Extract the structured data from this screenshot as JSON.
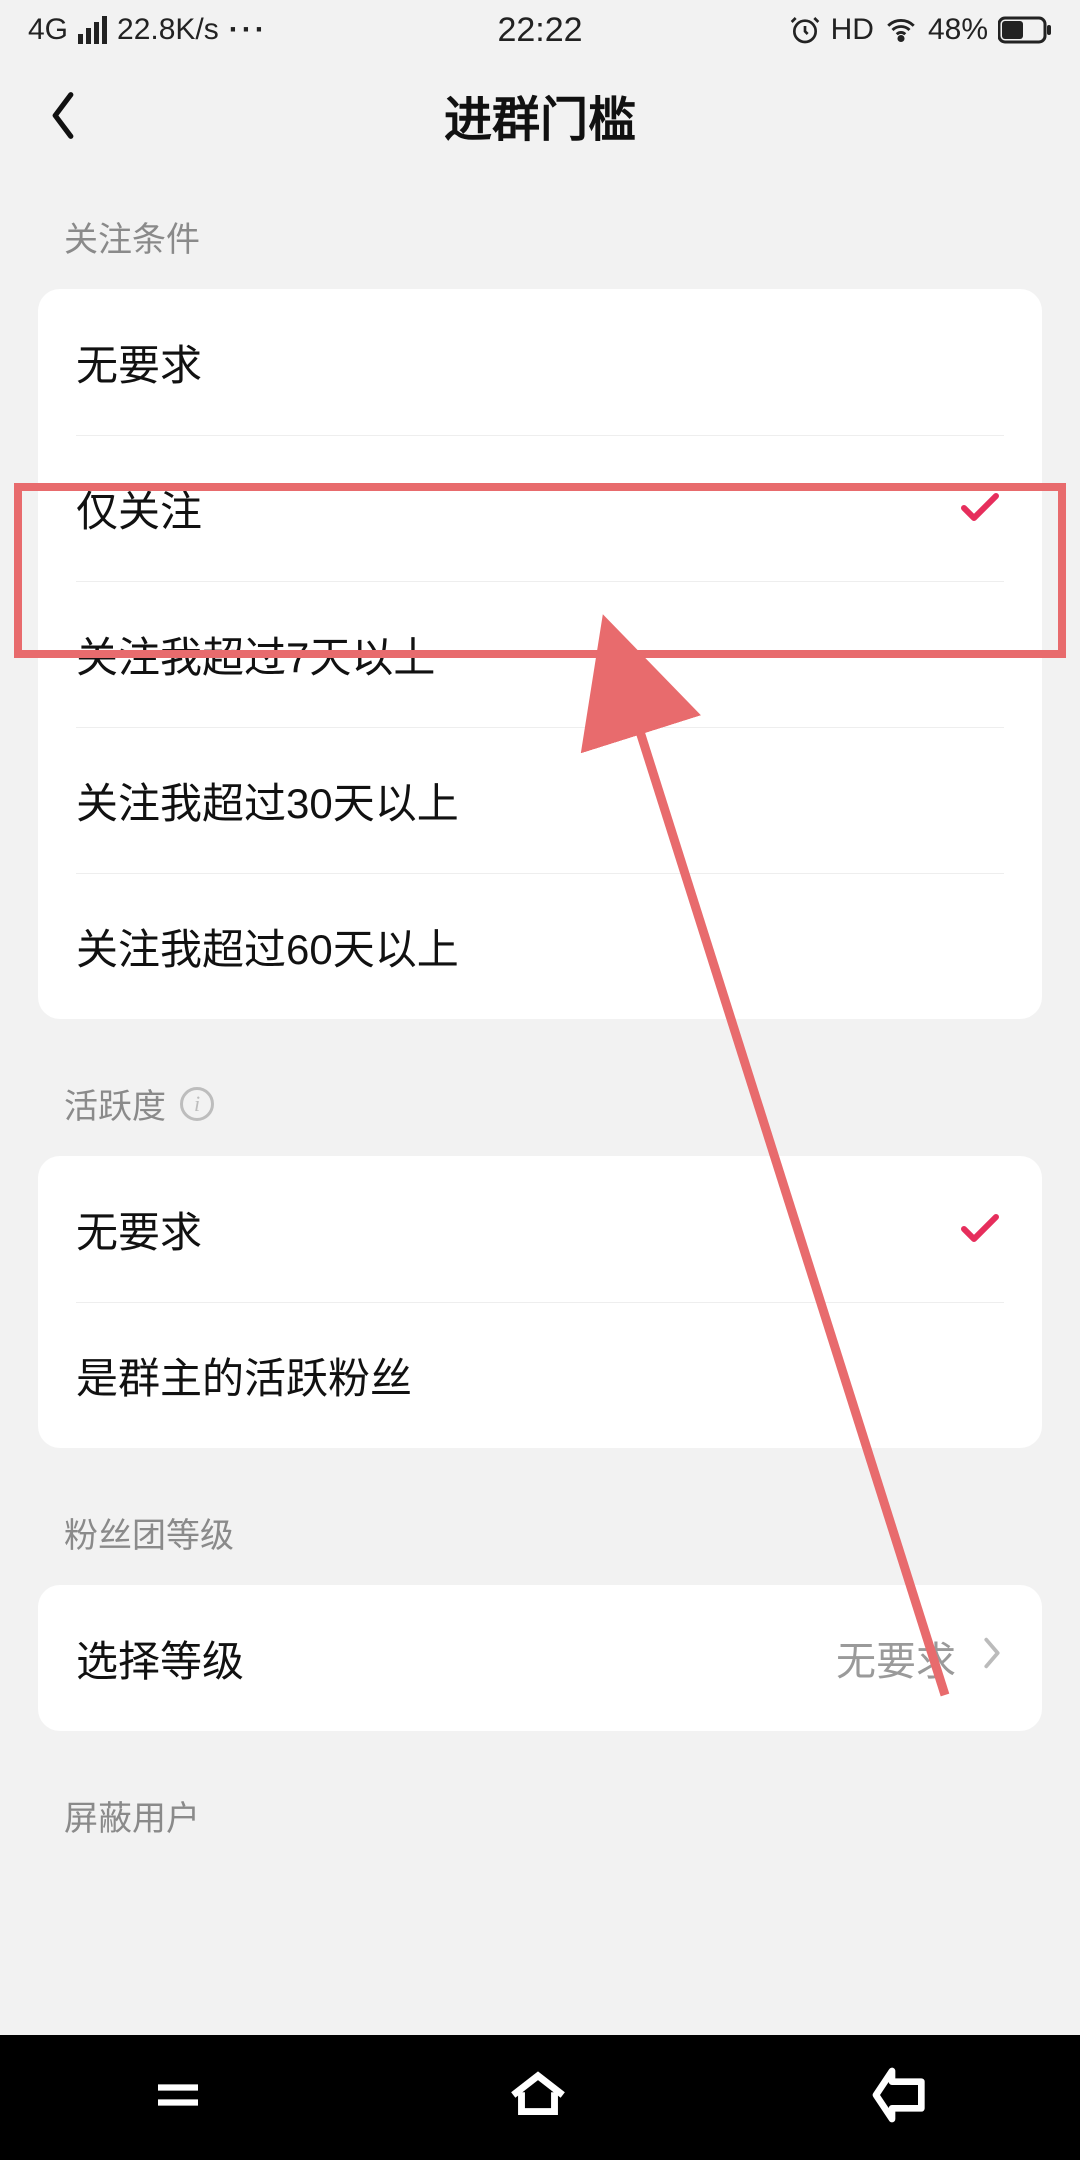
{
  "status": {
    "net": "4G",
    "speed": "22.8K/s",
    "time": "22:22",
    "hd": "HD",
    "battery": "48%"
  },
  "nav": {
    "title": "进群门槛"
  },
  "sections": {
    "follow": {
      "label": "关注条件",
      "items": [
        {
          "label": "无要求",
          "selected": false
        },
        {
          "label": "仅关注",
          "selected": true
        },
        {
          "label": "关注我超过7天以上",
          "selected": false
        },
        {
          "label": "关注我超过30天以上",
          "selected": false
        },
        {
          "label": "关注我超过60天以上",
          "selected": false
        }
      ]
    },
    "activity": {
      "label": "活跃度",
      "items": [
        {
          "label": "无要求",
          "selected": true
        },
        {
          "label": "是群主的活跃粉丝",
          "selected": false
        }
      ]
    },
    "fanLevel": {
      "label": "粉丝团等级",
      "row": {
        "label": "选择等级",
        "value": "无要求"
      }
    },
    "block": {
      "label": "屏蔽用户"
    }
  },
  "colors": {
    "accent": "#e62e5c",
    "annotation": "#e86b6d"
  }
}
